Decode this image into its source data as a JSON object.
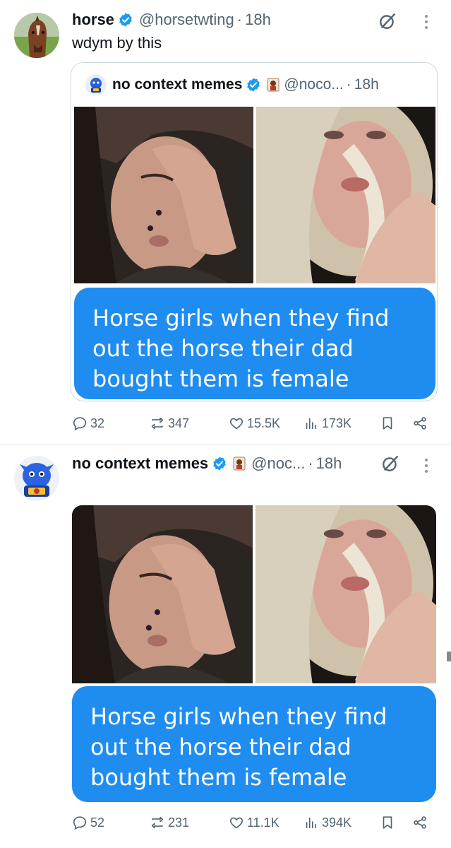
{
  "tweets": [
    {
      "author_name": "horse",
      "handle": "@horsetwting",
      "time": "18h",
      "text": "wdym by this",
      "quote": {
        "author_name": "no context memes",
        "handle": "@noco...",
        "time": "18h",
        "caption": "Horse girls when they find out the horse their dad bought them is female"
      },
      "stats": {
        "replies": "32",
        "reposts": "347",
        "likes": "15.5K",
        "views": "173K"
      }
    },
    {
      "author_name": "no context memes",
      "handle": "@noc...",
      "time": "18h",
      "caption": "Horse girls when they find out the horse their dad bought them is female",
      "stats": {
        "replies": "52",
        "reposts": "231",
        "likes": "11.1K",
        "views": "394K"
      }
    }
  ],
  "separator": "·",
  "colors": {
    "accent_blue": "#1d9bf0",
    "bubble_blue": "#1f8cf0",
    "muted": "#536471"
  },
  "icons": [
    "verified-badge-icon",
    "grok-icon",
    "more-icon",
    "reply-icon",
    "repost-icon",
    "like-icon",
    "views-icon",
    "bookmark-icon",
    "share-icon"
  ]
}
